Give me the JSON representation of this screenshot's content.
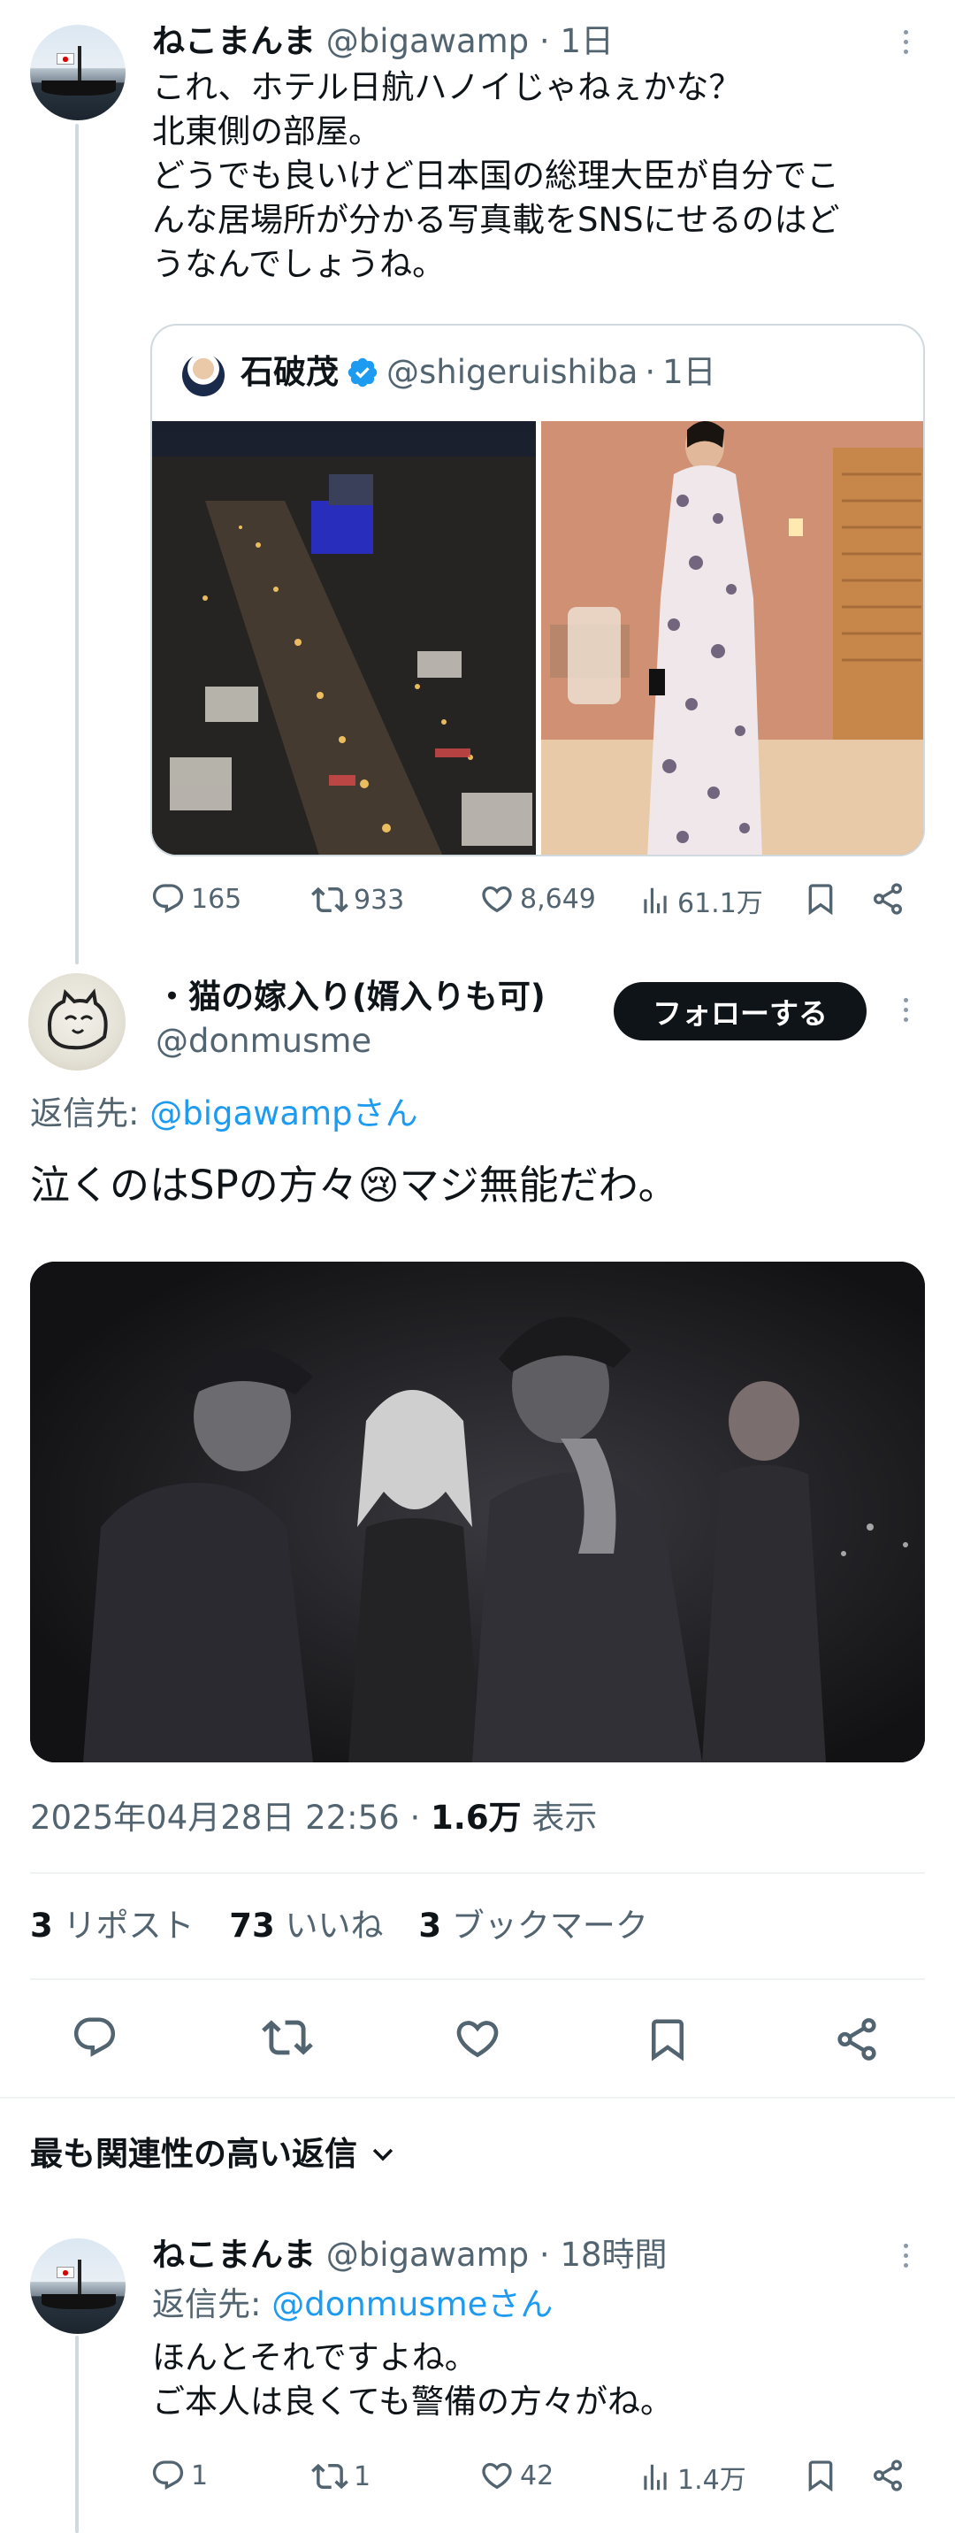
{
  "tweet1": {
    "display_name": "ねこまんま",
    "handle": "@bigawamp",
    "time": "1日",
    "text_lines": [
      "これ、ホテル日航ハノイじゃねぇかな？",
      "北東側の部屋。",
      "どうでも良いけど日本国の総理大臣が自分でこ",
      "んな居場所が分かる写真載をSNSにせるのはど",
      "うなんでしょうね。"
    ],
    "quote": {
      "display_name": "石破茂",
      "handle": "@shigeruishiba",
      "time": "1日"
    },
    "stats": {
      "replies": "165",
      "reposts": "933",
      "likes": "8,649",
      "views": "61.1万"
    }
  },
  "main": {
    "display_name": "・猫の嫁入り(婿入りも可)",
    "handle": "@donmusme",
    "follow_label": "フォローする",
    "reply_prefix": "返信先: ",
    "reply_to": "@bigawampさん",
    "text_a": "泣くのはSPの方々",
    "emoji": "😢",
    "text_b": "マジ無能だわ。",
    "timestamp": "2025年04月28日 22:56",
    "sep": " · ",
    "views_count": "1.6万",
    "views_label": " 表示",
    "reposts_count": "3",
    "reposts_label": "リポスト",
    "likes_count": "73",
    "likes_label": "いいね",
    "bookmarks_count": "3",
    "bookmarks_label": "ブックマーク"
  },
  "replies_filter": {
    "label": "最も関連性の高い返信"
  },
  "reply1": {
    "display_name": "ねこまんま",
    "handle": "@bigawamp",
    "time": "18時間",
    "reply_prefix": "返信先: ",
    "reply_to": "@donmusmeさん",
    "text_lines": [
      "ほんとそれですよね。",
      "ご本人は良くても警備の方々がね。"
    ],
    "stats": {
      "replies": "1",
      "reposts": "1",
      "likes": "42",
      "views": "1.4万"
    }
  },
  "colors": {
    "accent": "#1d9bf0",
    "text": "#0f1419",
    "muted": "#536471",
    "border": "#eff3f4",
    "follow_bg": "#0f1419"
  },
  "icons": [
    "reply-icon",
    "repost-icon",
    "like-icon",
    "views-icon",
    "bookmark-icon",
    "share-icon",
    "more-icon",
    "verified-icon",
    "chevron-down-icon"
  ]
}
